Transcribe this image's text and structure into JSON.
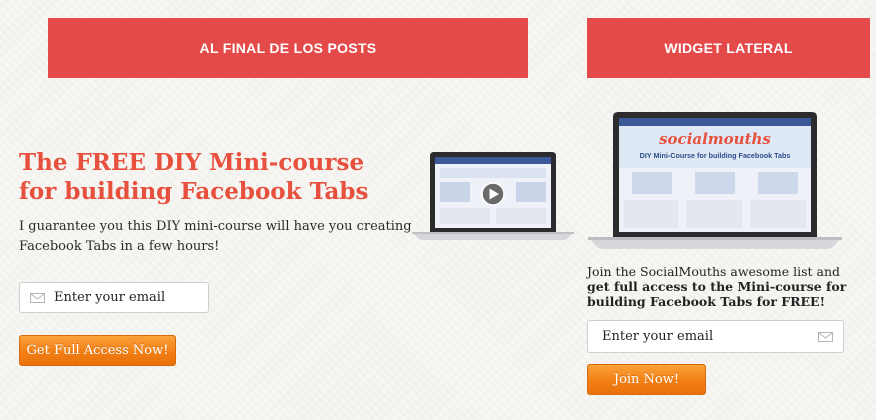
{
  "left": {
    "banner": "AL FINAL DE LOS POSTS",
    "headline": "The FREE DIY Mini-course for building Facebook Tabs",
    "description": "I guarantee you this DIY mini-course will have you creating Facebook Tabs in a few hours!",
    "email_placeholder": "Enter your email",
    "button_label": "Get Full Access Now!"
  },
  "right": {
    "banner": "WIDGET LATERAL",
    "intro": "Join the SocialMouths awesome list and",
    "intro_bold": "get full access to the Mini-course for building Facebook Tabs for FREE!",
    "email_placeholder": "Enter your email",
    "button_label": "Join Now!"
  },
  "laptop_screen": {
    "logo": "socialmouths",
    "title": "DIY Mini-Course for building Facebook Tabs"
  },
  "icons": {
    "mail": "mail-envelope-icon",
    "play": "play-icon",
    "laptop": "laptop-mockup"
  },
  "colors": {
    "banner": "#e54a4a",
    "headline": "#e8503e",
    "button": "#f27f14"
  }
}
